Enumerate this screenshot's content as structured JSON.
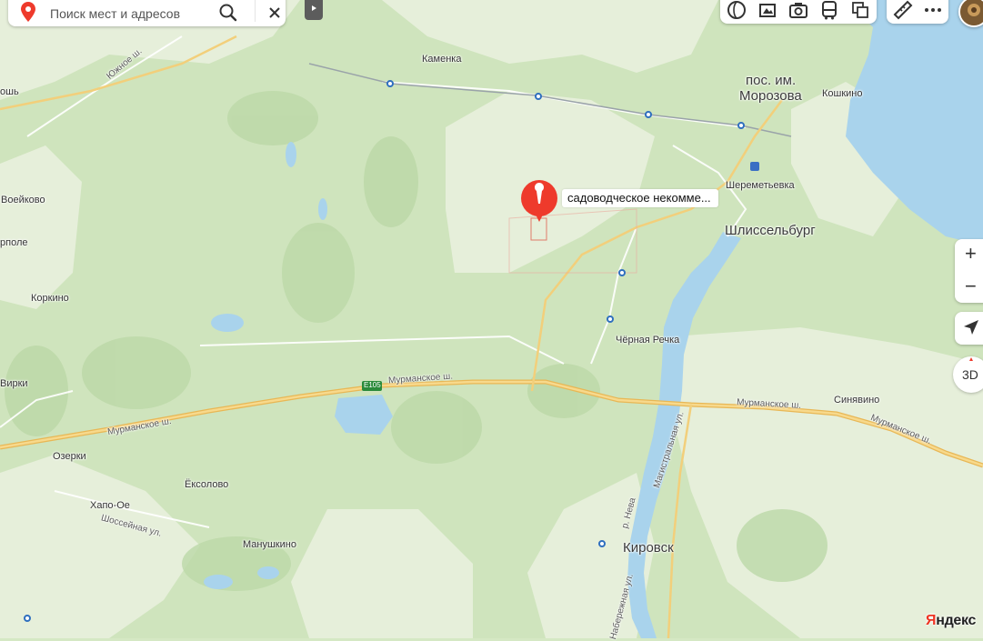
{
  "search": {
    "placeholder": "Поиск мест и адресов"
  },
  "marker": {
    "label": "садоводческое некомме..."
  },
  "labels": {
    "kamenka": "Каменка",
    "pos_im": "пос. им.",
    "morozova": "Морозова",
    "koshkino": "Кошкино",
    "sheremetevka": "Шереметьевка",
    "shlisselburg": "Шлиссельбург",
    "voeikovo": "Воейково",
    "rpole": "рполе",
    "korkino": "Коркино",
    "chernaya_rechka": "Чёрная Речка",
    "virki": "Вирки",
    "murmanskoe1": "Мурманское ш.",
    "murmanskoe2": "Мурманское ш.",
    "murmanskoe3": "Мурманское ш.",
    "murmanskoe4": "Мурманское ш.",
    "sinyavino": "Синявино",
    "ozerki": "Озерки",
    "eksolovo": "Ёксолово",
    "khapo_oe": "Хапо-Ое",
    "shosseinaya": "Шоссейная ул.",
    "manushkino": "Манушкино",
    "kirovsk": "Кировск",
    "magistralnaya": "Магистральная ул.",
    "neva": "р. Нева",
    "naberezhnaya": "Набережная ул.",
    "yuzhnoe": "Южное ш.",
    "osh": "ошь",
    "e105": "E105"
  },
  "controls": {
    "three_d": "3D",
    "zoom_in": "+",
    "zoom_out": "−"
  },
  "brand": {
    "first": "Я",
    "rest": "ндекс"
  },
  "colors": {
    "forest": "#cde3bb",
    "forest_dark": "#bcd9a8",
    "field": "#e9f1de",
    "water": "#a9d3ec",
    "highway": "#f2c76b",
    "marker": "#ee3a2c",
    "transit_stop": "#2f6fbf"
  }
}
